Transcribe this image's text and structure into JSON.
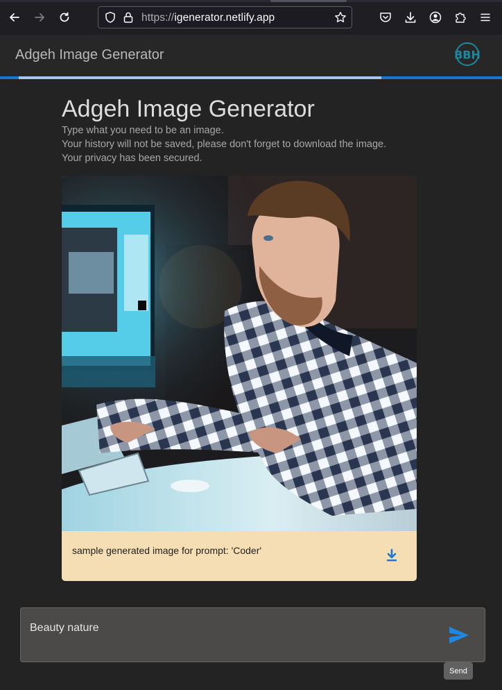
{
  "browser": {
    "url_scheme": "https://",
    "url_host": "igenerator.netlify.app"
  },
  "header": {
    "app_title": "Adgeh Image Generator",
    "logo_text": "BBH",
    "progress_fraction": 0.75
  },
  "main": {
    "title": "Adgeh Image Generator",
    "intro": [
      "Type what you need to be an image.",
      "Your history will not be saved, please don't forget to download the image.",
      "Your privacy has been secured."
    ]
  },
  "card": {
    "caption": "sample generated image for prompt: 'Coder'",
    "download_icon": "download-icon",
    "image_alt": "generated image: young man with beard in plaid shirt at computer"
  },
  "prompt": {
    "value": "Beauty nature",
    "send_icon": "send-icon",
    "tooltip": "Send"
  },
  "colors": {
    "accent": "#1976d2",
    "card_bg": "#f5deb3",
    "send_icon": "#1e88e5"
  }
}
